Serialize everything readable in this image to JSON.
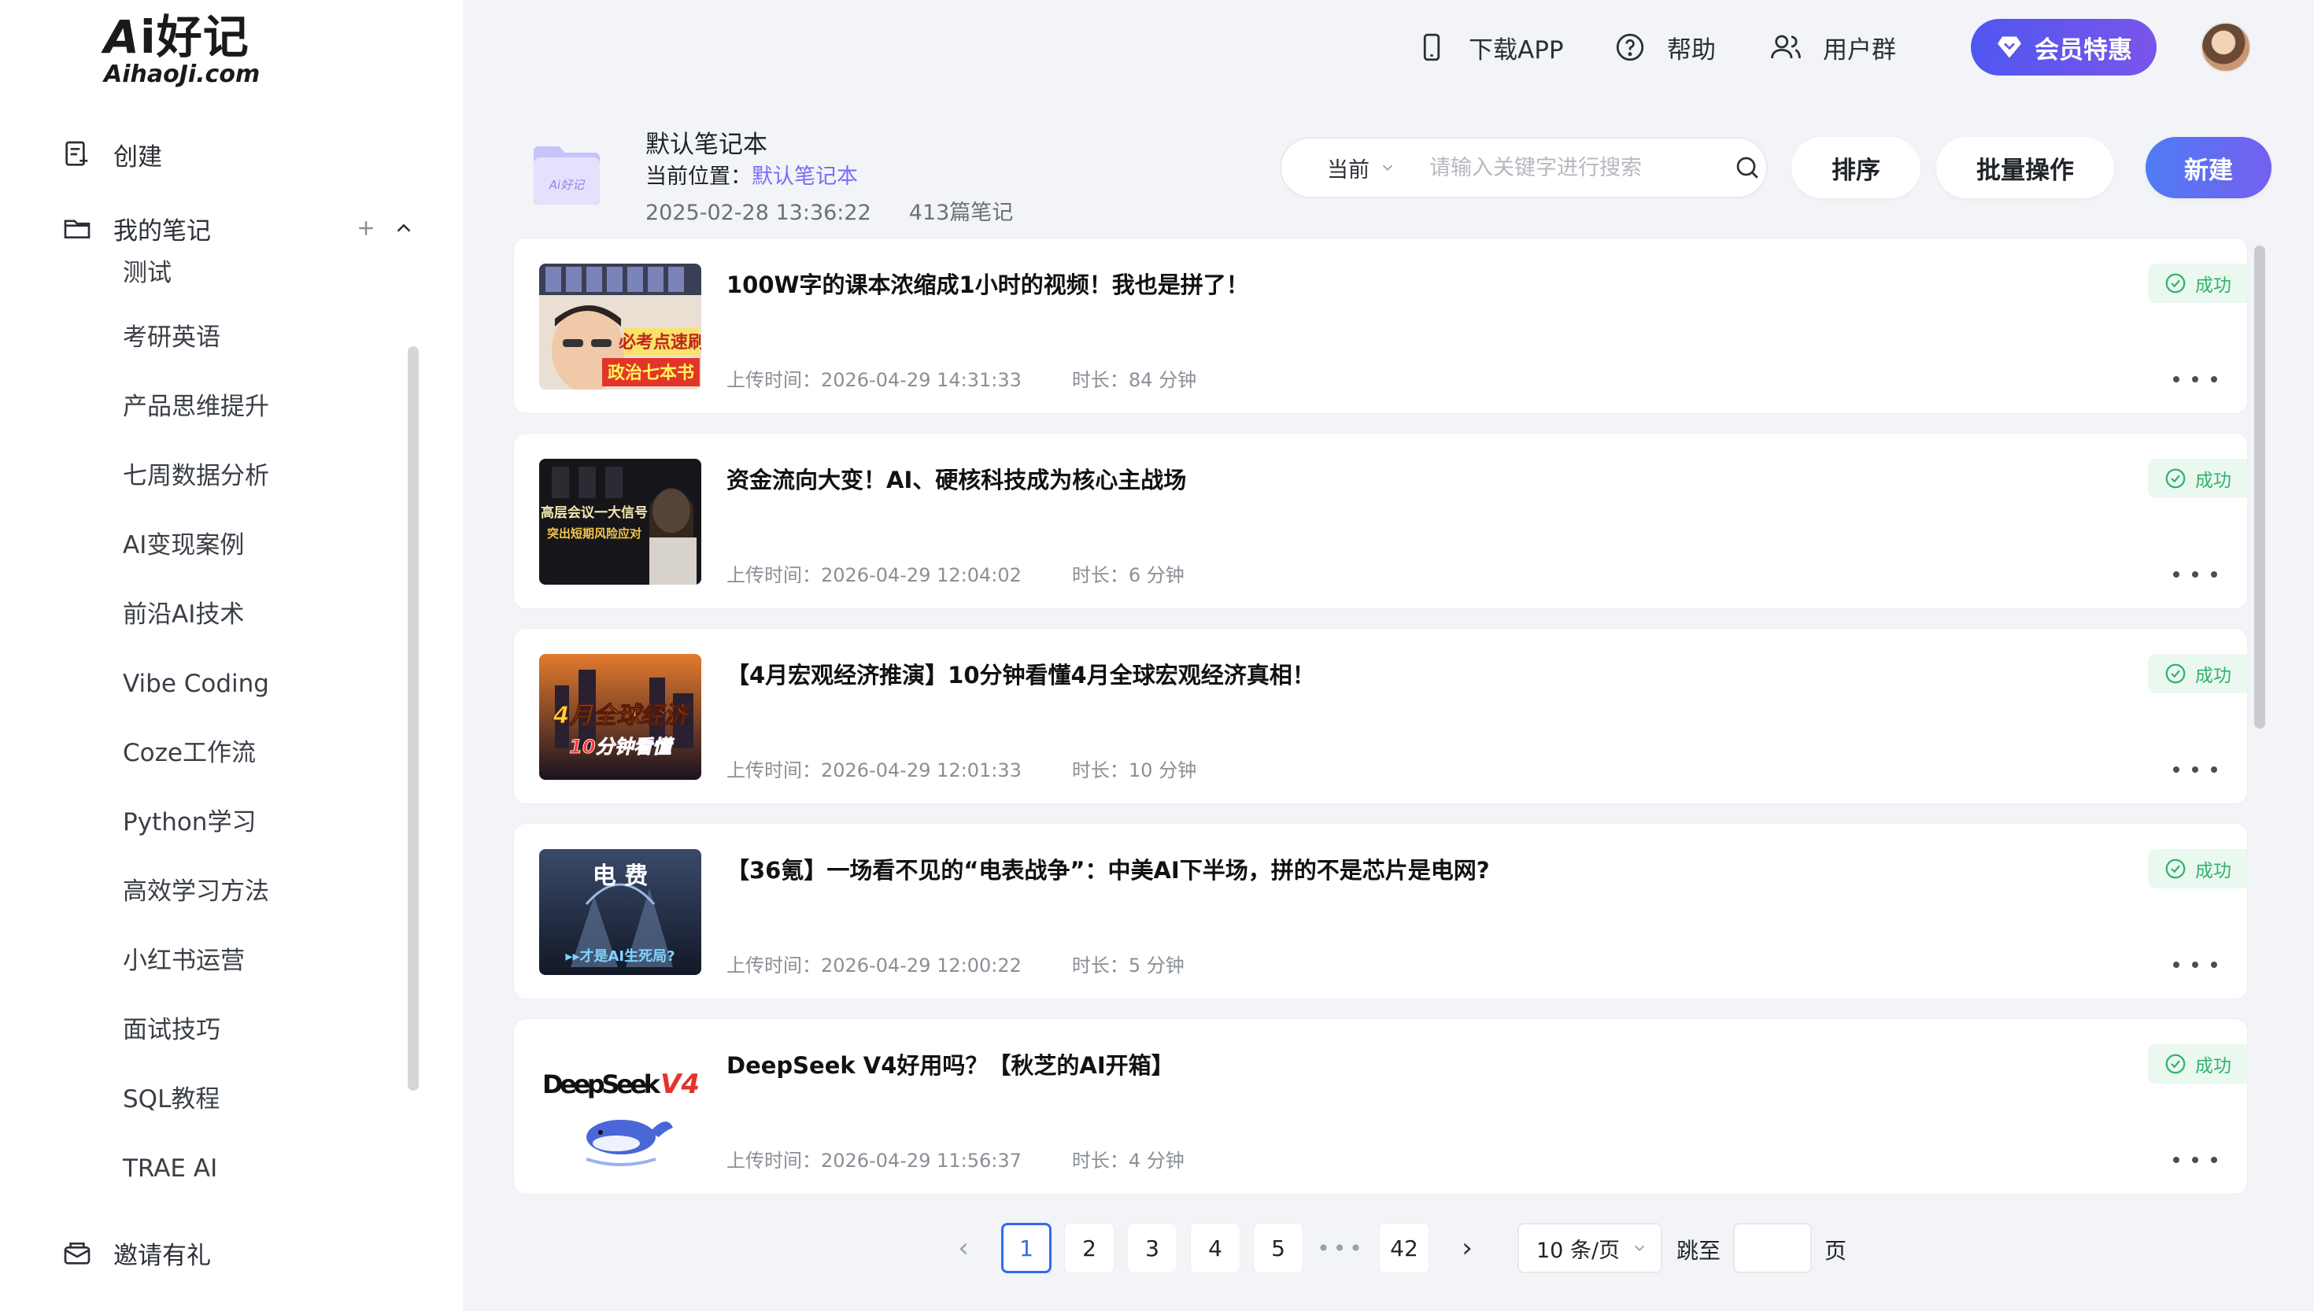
{
  "logo": {
    "brand": "i好记",
    "brand_initial": "A",
    "domain": "AihaoJi.com"
  },
  "sidebar": {
    "create_label": "创建",
    "my_notes_label": "我的笔记",
    "notebooks": [
      "测试",
      "考研英语",
      "产品思维提升",
      "七周数据分析",
      "AI变现案例",
      "前沿AI技术",
      "Vibe Coding",
      "Coze工作流",
      "Python学习",
      "高效学习方法",
      "小红书运营",
      "面试技巧",
      "SQL教程",
      "TRAE AI"
    ],
    "invite_label": "邀请有礼"
  },
  "topbar": {
    "download_app": "下载APP",
    "help": "帮助",
    "user_group": "用户群",
    "vip": "会员特惠"
  },
  "notebook": {
    "title": "默认笔记本",
    "location_prefix": "当前位置：",
    "location_link": "默认笔记本",
    "datetime": "2025-02-28 13:36:22",
    "count": "413篇笔记"
  },
  "search": {
    "scope": "当前",
    "placeholder": "请输入关键字进行搜索"
  },
  "actions": {
    "sort": "排序",
    "batch": "批量操作",
    "new": "新建"
  },
  "notes": [
    {
      "title": "100W字的课本浓缩成1小时的视频！我也是拼了！",
      "upload": "上传时间：2026-04-29 14:31:33",
      "duration": "时长：84 分钟",
      "status": "成功",
      "thumb_text": "必考点速刷",
      "thumb_text2": "政治七本书"
    },
    {
      "title": "资金流向大变！AI、硬核科技成为核心主战场",
      "upload": "上传时间：2026-04-29 12:04:02",
      "duration": "时长：6 分钟",
      "status": "成功",
      "thumb_text": "高层会议一大信号",
      "thumb_text2": "突出短期风险应对"
    },
    {
      "title": "【4月宏观经济推演】10分钟看懂4月全球宏观经济真相！",
      "upload": "上传时间：2026-04-29 12:01:33",
      "duration": "时长：10 分钟",
      "status": "成功",
      "thumb_text": "4月全球经济",
      "thumb_text2": "10分钟看懂"
    },
    {
      "title": "【36氪】一场看不见的“电表战争”：中美AI下半场，拼的不是芯片是电网?",
      "upload": "上传时间：2026-04-29 12:00:22",
      "duration": "时长：5 分钟",
      "status": "成功",
      "thumb_text": "电 费",
      "thumb_text2": "▸▸才是AI生死局?"
    },
    {
      "title": "DeepSeek V4好用吗？【秋芝的AI开箱】",
      "upload": "上传时间：2026-04-29 11:56:37",
      "duration": "时长：4 分钟",
      "status": "成功",
      "thumb_text": "DeepSeek",
      "thumb_text2": "V4"
    }
  ],
  "pagination": {
    "pages": [
      "1",
      "2",
      "3",
      "4",
      "5"
    ],
    "ellipsis": "•••",
    "last": "42",
    "current": 1,
    "page_size": "10 条/页",
    "jump_label": "跳至",
    "page_suffix": "页"
  },
  "colors": {
    "accent": "#7b6cf6",
    "primary_blue": "#2f6bf2",
    "success": "#2fb36b"
  }
}
